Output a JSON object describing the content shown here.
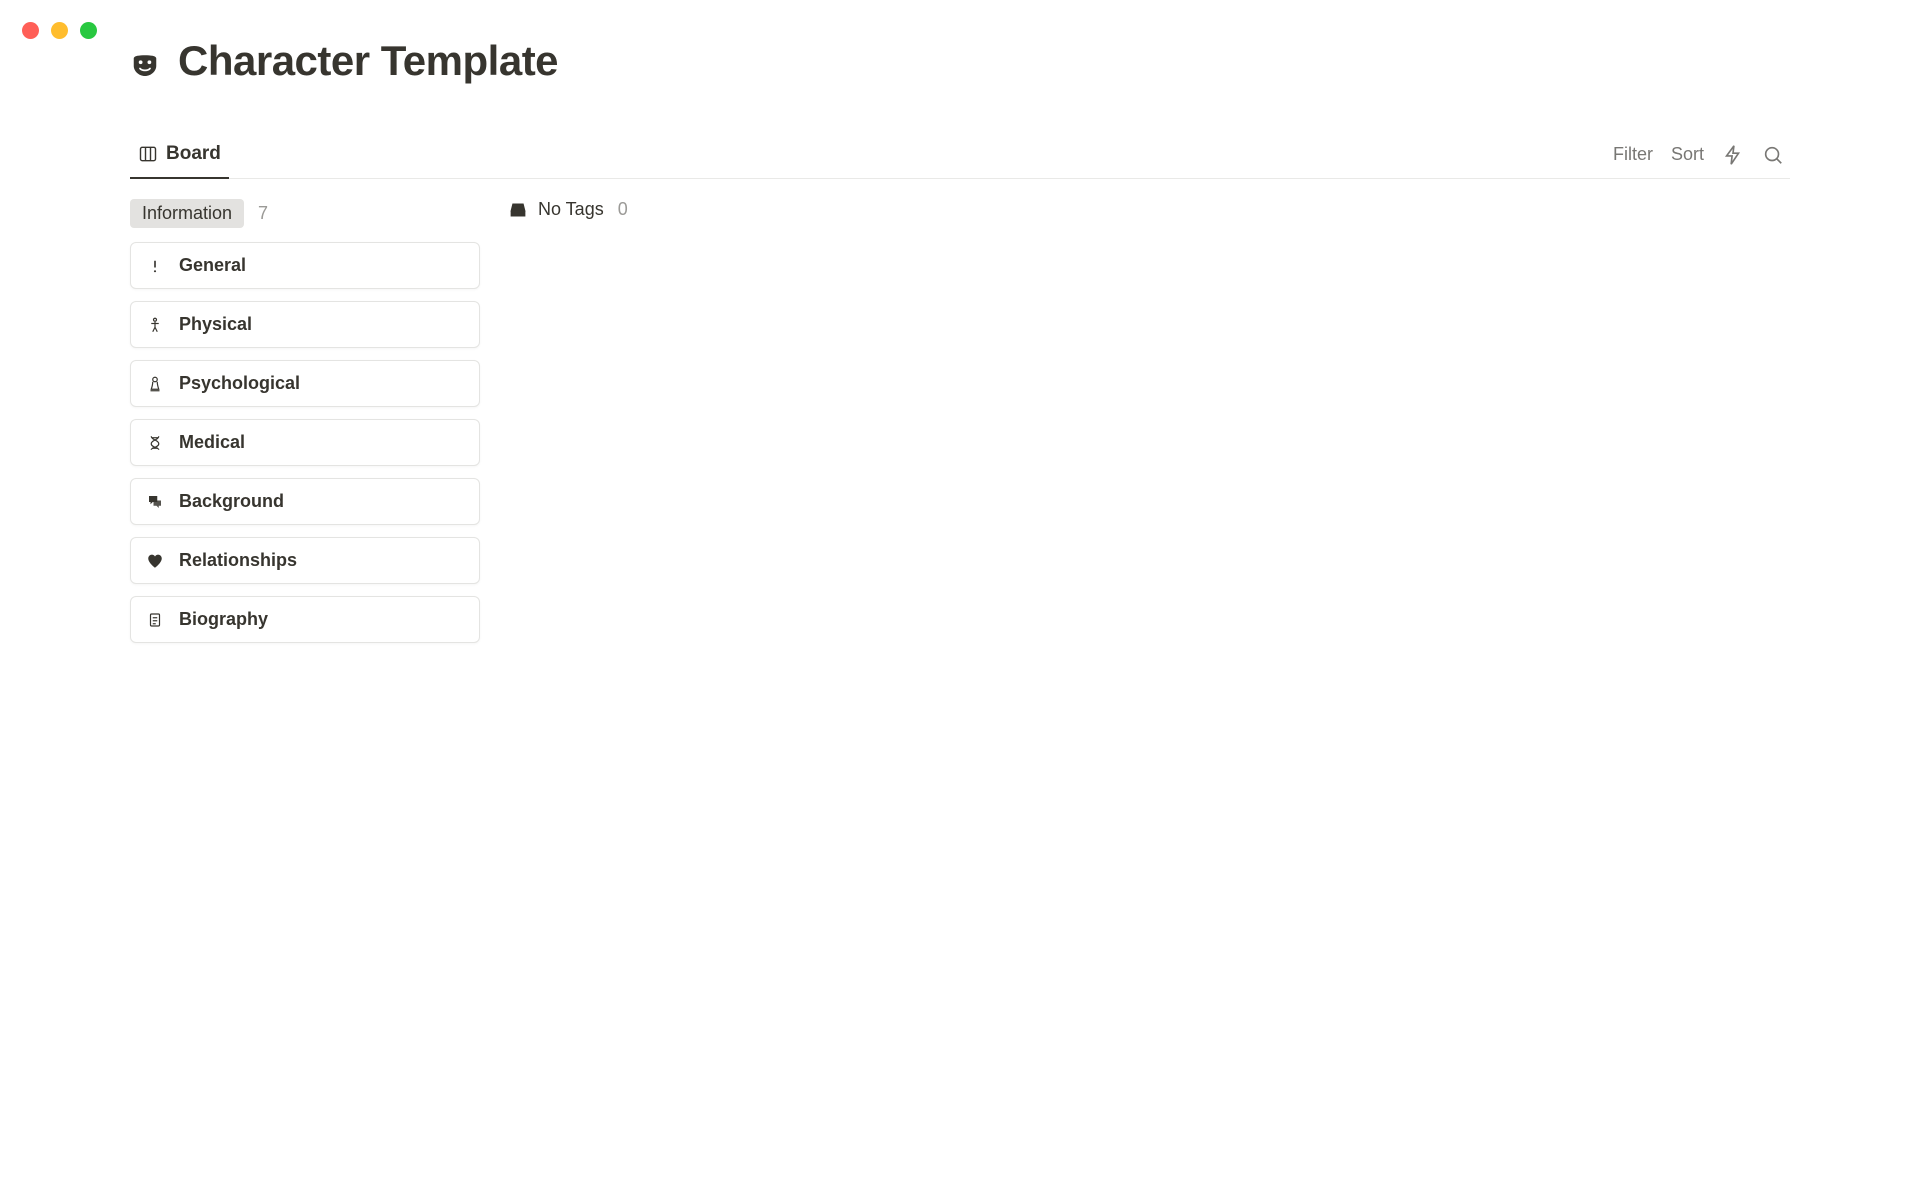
{
  "page": {
    "title": "Character Template"
  },
  "tabs": {
    "board": "Board"
  },
  "toolbar": {
    "filter": "Filter",
    "sort": "Sort"
  },
  "columns": {
    "info": {
      "label": "Information",
      "count": "7"
    },
    "notags": {
      "label": "No Tags",
      "count": "0"
    }
  },
  "cards": {
    "general": "General",
    "physical": "Physical",
    "psychological": "Psychological",
    "medical": "Medical",
    "background": "Background",
    "relationships": "Relationships",
    "biography": "Biography"
  }
}
